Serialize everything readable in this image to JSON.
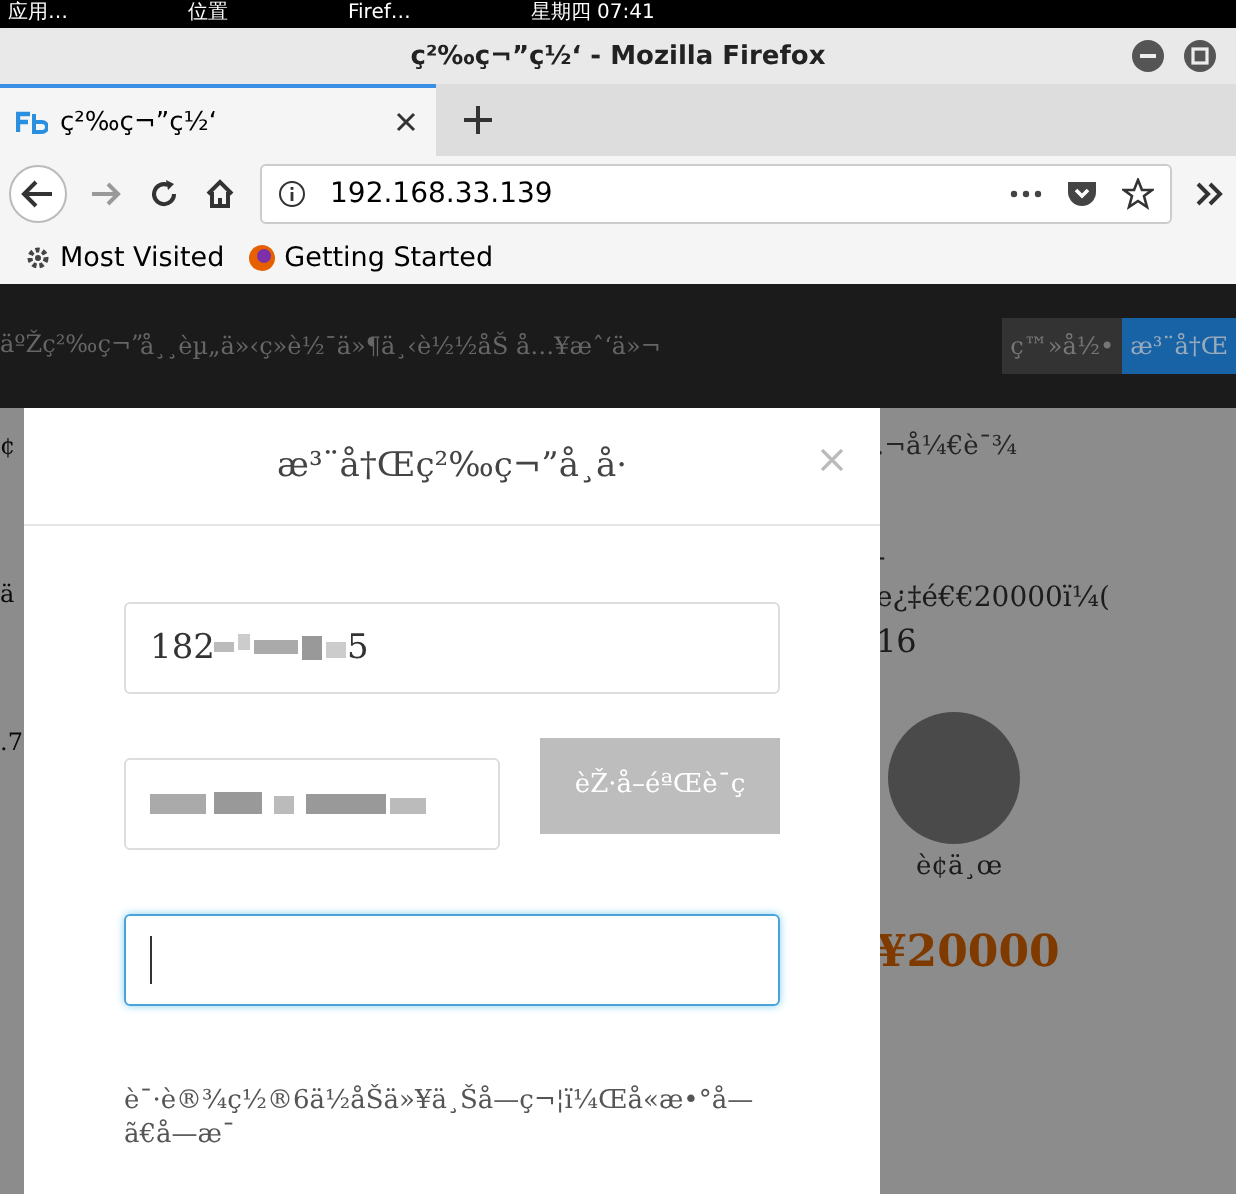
{
  "system_bar": {
    "items": [
      "应用…",
      "位置",
      "Firef…",
      "星期四 07:41"
    ]
  },
  "window": {
    "title": "ç²‰ç¬”ç½‘ - Mozilla Firefox"
  },
  "tabs": [
    {
      "label": "ç²‰ç¬”ç½‘",
      "selected": true
    }
  ],
  "address_bar": {
    "url": "192.168.33.139"
  },
  "bookmarks": [
    "Most Visited",
    "Getting Started"
  ],
  "site_header": {
    "logo": "äºŽç²‰ç¬”",
    "nav": "å¸¸èµ„ä»‹ç»è½¯ä»¶ä¸‹è½½åŠ å…¥æˆ‘ä»¬",
    "login": "ç™»å½•",
    "register": "æ³¨å†Œ"
  },
  "background": {
    "left": [
      "¢",
      "ä",
      ".7"
    ],
    "notice": ".¬å¼€è¯¾",
    "course_title": [
      "-",
      "e¿‡é€€20000ï¼("
    ],
    "date": "16",
    "teacher": "è¢ä¸œ",
    "price": "¥20000"
  },
  "modal": {
    "title": "æ³¨å†Œç²‰ç¬”å¸å·",
    "phone": {
      "start": "182",
      "end": "5"
    },
    "code_button": {
      "label": "èŽ·å–éªŒè¯ç ",
      "disabled": true
    },
    "password": {
      "focused": true
    },
    "hint": "è¯·è®¾ç½®6ä½åŠä»¥ä¸Šå­—ç¬¦ï¼Œå«æ•°å—ã€å­—æ¯"
  }
}
